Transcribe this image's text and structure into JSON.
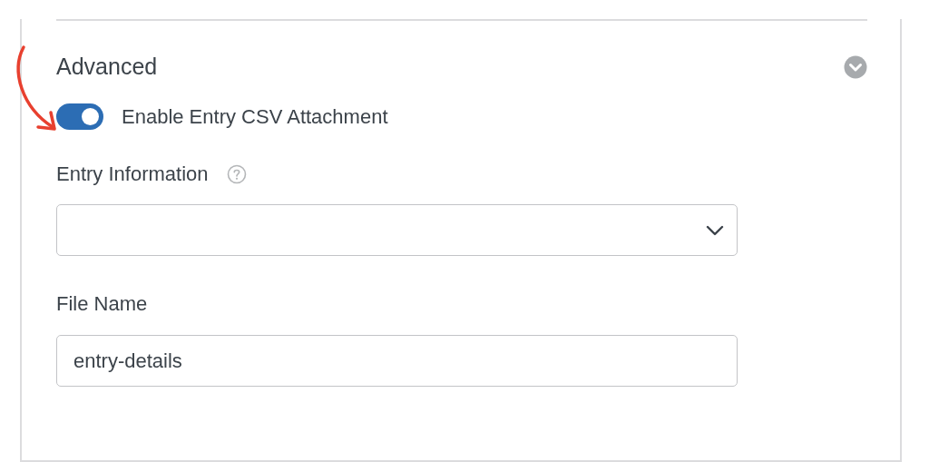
{
  "section": {
    "title": "Advanced",
    "expanded": true
  },
  "toggle": {
    "label": "Enable Entry CSV Attachment",
    "on": true
  },
  "fields": [
    {
      "kind": "select",
      "label": "Entry Information",
      "help": true
    },
    {
      "kind": "text",
      "label": "File Name",
      "value": "entry-details"
    }
  ]
}
